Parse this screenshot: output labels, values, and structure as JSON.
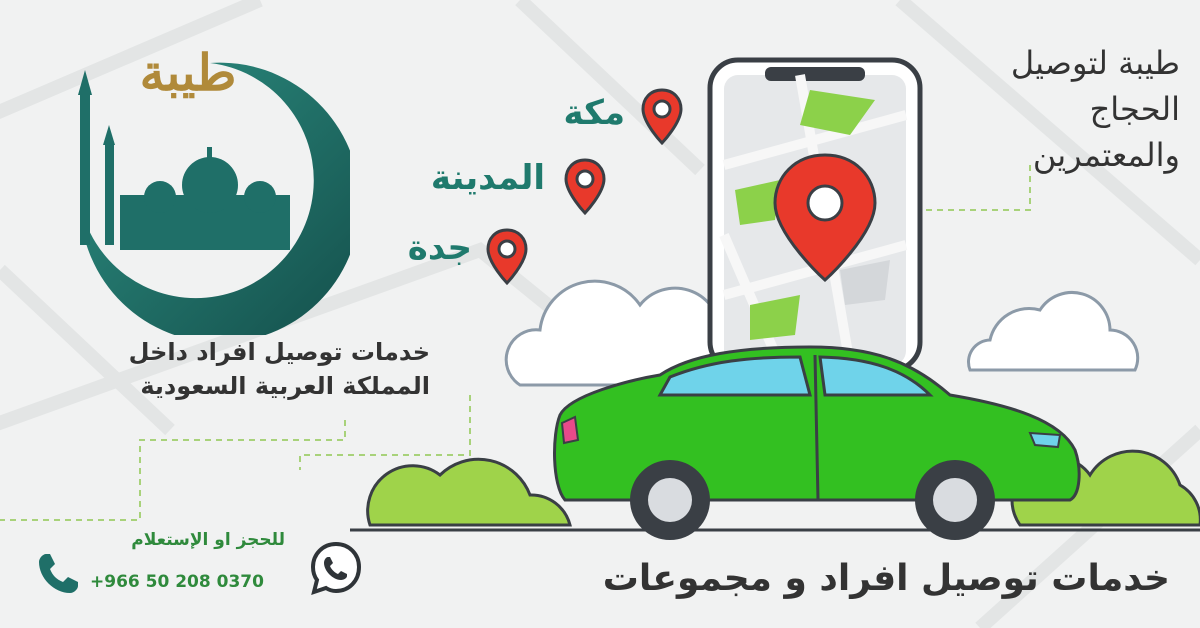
{
  "brand": {
    "logo_text": "طيبة"
  },
  "headline": {
    "lines": [
      "طيبة لتوصيل",
      "الحجاج",
      "والمعتمرين"
    ]
  },
  "tagline": {
    "lines": [
      "خدمات توصيل افراد داخل",
      "المملكة العربية السعودية"
    ]
  },
  "cities": [
    "مكة",
    "المدينة",
    "جدة"
  ],
  "contact": {
    "booking_label": "للحجز او الإستعلام",
    "phone": "+966 50 208 0370"
  },
  "footer": {
    "title": "خدمات توصيل افراد و مجموعات"
  },
  "colors": {
    "teal": "#1f6f68",
    "gold": "#b08a3a",
    "pin_red": "#e8392b",
    "car_green": "#33c021",
    "bush_green": "#9fd34a",
    "contact_green": "#2f8a3c"
  }
}
